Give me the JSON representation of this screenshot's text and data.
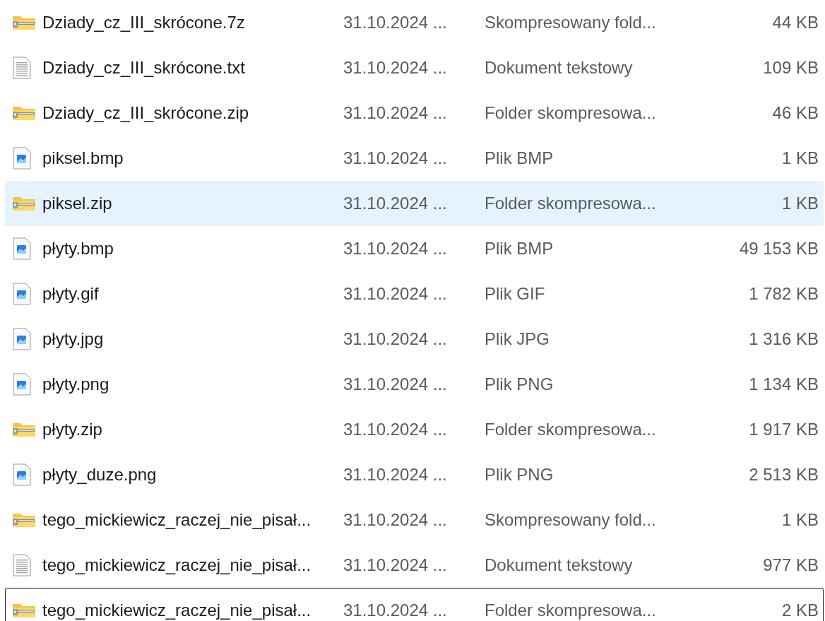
{
  "files": [
    {
      "kind": "zip",
      "name": "Dziady_cz_III_skrócone.7z",
      "date": "31.10.2024 ...",
      "type": "Skompresowany fold...",
      "size": "44 KB",
      "hovered": false,
      "focused": false
    },
    {
      "kind": "text",
      "name": "Dziady_cz_III_skrócone.txt",
      "date": "31.10.2024 ...",
      "type": "Dokument tekstowy",
      "size": "109 KB",
      "hovered": false,
      "focused": false
    },
    {
      "kind": "zip",
      "name": "Dziady_cz_III_skrócone.zip",
      "date": "31.10.2024 ...",
      "type": "Folder skompresowa...",
      "size": "46 KB",
      "hovered": false,
      "focused": false
    },
    {
      "kind": "image",
      "name": "piksel.bmp",
      "date": "31.10.2024 ...",
      "type": "Plik BMP",
      "size": "1 KB",
      "hovered": false,
      "focused": false
    },
    {
      "kind": "zip",
      "name": "piksel.zip",
      "date": "31.10.2024 ...",
      "type": "Folder skompresowa...",
      "size": "1 KB",
      "hovered": true,
      "focused": false
    },
    {
      "kind": "image",
      "name": "płyty.bmp",
      "date": "31.10.2024 ...",
      "type": "Plik BMP",
      "size": "49 153 KB",
      "hovered": false,
      "focused": false
    },
    {
      "kind": "image",
      "name": "płyty.gif",
      "date": "31.10.2024 ...",
      "type": "Plik GIF",
      "size": "1 782 KB",
      "hovered": false,
      "focused": false
    },
    {
      "kind": "image",
      "name": "płyty.jpg",
      "date": "31.10.2024 ...",
      "type": "Plik JPG",
      "size": "1 316 KB",
      "hovered": false,
      "focused": false
    },
    {
      "kind": "image",
      "name": "płyty.png",
      "date": "31.10.2024 ...",
      "type": "Plik PNG",
      "size": "1 134 KB",
      "hovered": false,
      "focused": false
    },
    {
      "kind": "zip",
      "name": "płyty.zip",
      "date": "31.10.2024 ...",
      "type": "Folder skompresowa...",
      "size": "1 917 KB",
      "hovered": false,
      "focused": false
    },
    {
      "kind": "image",
      "name": "płyty_duze.png",
      "date": "31.10.2024 ...",
      "type": "Plik PNG",
      "size": "2 513 KB",
      "hovered": false,
      "focused": false
    },
    {
      "kind": "zip",
      "name": "tego_mickiewicz_raczej_nie_pisał...",
      "date": "31.10.2024 ...",
      "type": "Skompresowany fold...",
      "size": "1 KB",
      "hovered": false,
      "focused": false
    },
    {
      "kind": "text",
      "name": "tego_mickiewicz_raczej_nie_pisał...",
      "date": "31.10.2024 ...",
      "type": "Dokument tekstowy",
      "size": "977 KB",
      "hovered": false,
      "focused": false
    },
    {
      "kind": "zip",
      "name": "tego_mickiewicz_raczej_nie_pisał...",
      "date": "31.10.2024 ...",
      "type": "Folder skompresowa...",
      "size": "2 KB",
      "hovered": false,
      "focused": true
    }
  ]
}
